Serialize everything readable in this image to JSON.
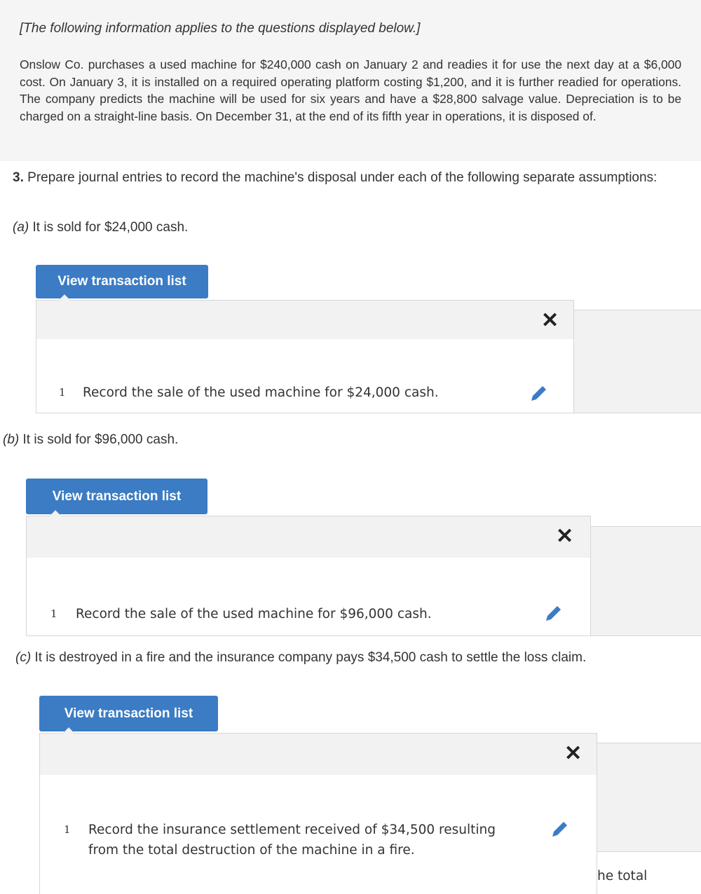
{
  "intro": {
    "heading": "[The following information applies to the questions displayed below.]",
    "text": "Onslow Co. purchases a used machine for $240,000 cash on January 2 and readies it for use the next day at a $6,000 cost. On January 3, it is installed on a required operating platform costing $1,200, and it is further readied for operations. The company predicts the machine will be used for six years and have a $28,800 salvage value. Depreciation is to be charged on a straight-line basis. On December 31, at the end of its fifth year in operations, it is disposed of."
  },
  "question": {
    "number": "3.",
    "text": "Prepare journal entries to record the machine's disposal under each of the following separate assumptions:"
  },
  "parts": [
    {
      "label": "(a)",
      "text": "It is sold for $24,000 cash.",
      "button_label": "View transaction list",
      "close_label": "✕",
      "row_number": "1",
      "row_text": "Record the sale of the used machine for $24,000 cash."
    },
    {
      "label": "(b)",
      "text": "It is sold for $96,000 cash.",
      "button_label": "View transaction list",
      "close_label": "✕",
      "row_number": "1",
      "row_text": "Record the sale of the used machine for $96,000 cash."
    },
    {
      "label": "(c)",
      "text": "It is destroyed in a fire and the insurance company pays $34,500 cash to settle the loss claim.",
      "button_label": "View transaction list",
      "close_label": "✕",
      "row_number": "1",
      "row_text": "Record the insurance settlement received of $34,500 resulting from the total destruction of the machine in a fire.",
      "side_text": "he total"
    }
  ],
  "icons": {
    "close": "close-icon",
    "edit": "pencil-icon"
  },
  "colors": {
    "button": "#3b7cc4",
    "intro_bg": "#f5f5f5",
    "panel_head": "#f2f2f2"
  }
}
